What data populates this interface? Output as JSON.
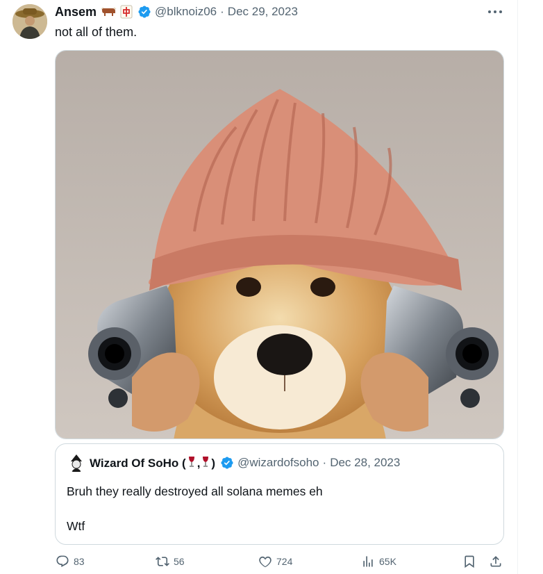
{
  "post": {
    "author_name": "Ansem",
    "handle": "@blknoiz06",
    "separator": "·",
    "date": "Dec 29, 2023",
    "text": "not all of them.",
    "name_emojis": [
      "bull-emoji",
      "mahjong-red-dragon-emoji"
    ],
    "verified": true
  },
  "quote": {
    "author_name": "Wizard Of SoHo (",
    "name_mid": ",",
    "name_end": ")",
    "handle": "@wizardofsoho",
    "separator": "·",
    "date": "Dec 28, 2023",
    "line1": "Bruh they really destroyed all solana memes eh",
    "line2": "Wtf",
    "verified": true
  },
  "actions": {
    "replies": "83",
    "reposts": "56",
    "likes": "724",
    "views": "65K"
  },
  "colors": {
    "accent": "#1d9bf0",
    "muted": "#536471",
    "border": "#cfd9de"
  },
  "icons": [
    "more-icon",
    "verified-badge-icon",
    "reply-icon",
    "repost-icon",
    "like-icon",
    "views-icon",
    "bookmark-icon",
    "share-icon"
  ]
}
